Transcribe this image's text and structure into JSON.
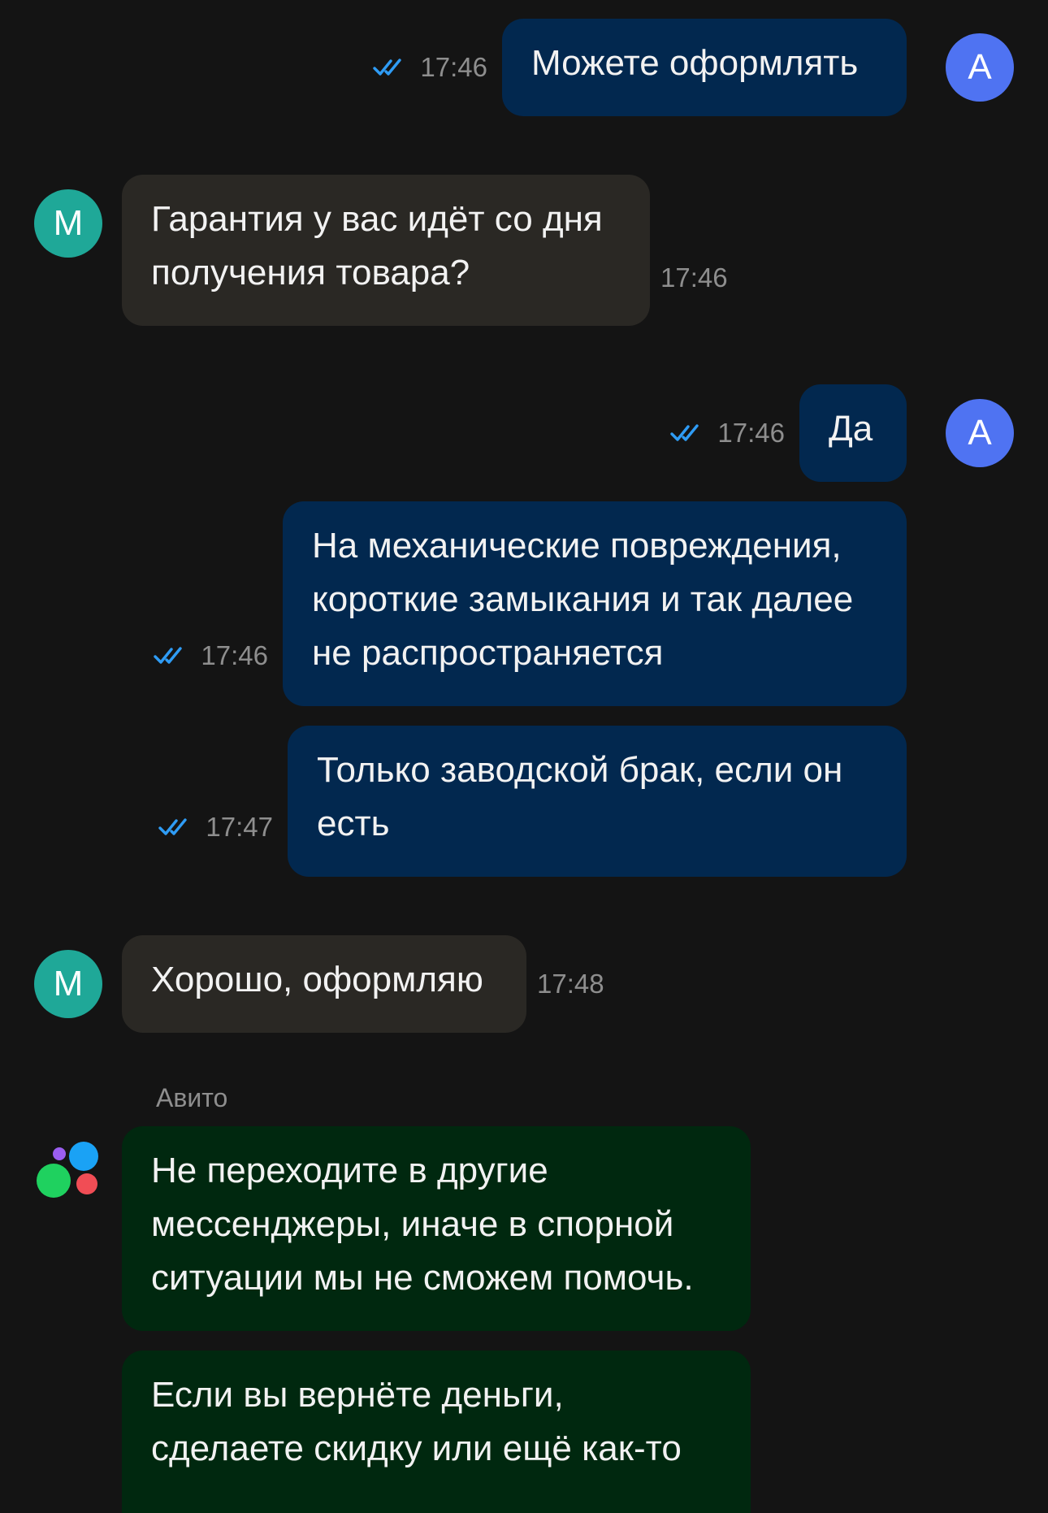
{
  "messages": [
    {
      "side": "out",
      "text": "Можете оформлять",
      "time": "17:46",
      "avatar": "А"
    },
    {
      "side": "in",
      "text": "Гарантия у вас идёт со дня получения товара?",
      "time": "17:46",
      "avatar": "М"
    },
    {
      "side": "out",
      "text": "Да",
      "time": "17:46",
      "avatar": "А"
    },
    {
      "side": "out",
      "text": "На механические повреждения, короткие замыкания и так далее не распространяется",
      "time": "17:46"
    },
    {
      "side": "out",
      "text": "Только заводской брак, если он есть",
      "time": "17:47"
    },
    {
      "side": "in",
      "text": "Хорошо, оформляю",
      "time": "17:48",
      "avatar": "М"
    }
  ],
  "system": {
    "sender": "Авито",
    "logo_icon": "avito-logo-icon",
    "messages": [
      "Не переходите в другие мессенджеры, иначе в спорной ситуации мы не сможем помочь.",
      "Если вы вернёте деньги, сделаете скидку или ещё как-то"
    ]
  },
  "icons": {
    "read_status": "double-check-icon"
  },
  "colors": {
    "background": "#141414",
    "outgoing_bubble": "#02284f",
    "incoming_bubble": "#2a2824",
    "system_bubble": "#00280f",
    "my_avatar": "#4f73f2",
    "seller_avatar": "#1fa898",
    "read_check": "#2f9cf5",
    "timestamp": "#8e8e8e"
  }
}
